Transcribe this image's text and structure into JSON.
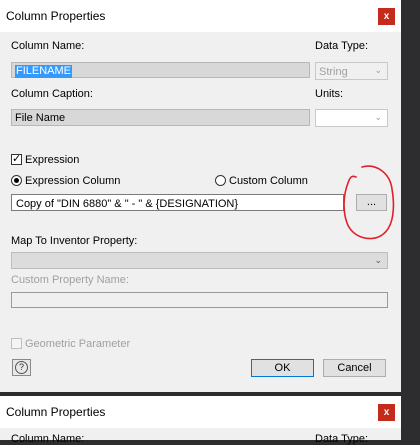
{
  "dialog": {
    "title": "Column Properties",
    "close_glyph": "x",
    "column_name_label": "Column Name:",
    "column_name_value": "FILENAME",
    "data_type_label": "Data Type:",
    "data_type_value": "String",
    "column_caption_label": "Column Caption:",
    "column_caption_value": "File Name",
    "units_label": "Units:",
    "expression_label": "Expression",
    "expression_checked": true,
    "expression_column_label": "Expression Column",
    "custom_column_label": "Custom Column",
    "expression_value": "Copy of \"DIN 6880\" & \" - \" & {DESIGNATION}",
    "ellipsis_label": "...",
    "map_label": "Map To Inventor Property:",
    "custom_property_label": "Custom Property Name:",
    "geometric_label": "Geometric Parameter",
    "ok_label": "OK",
    "cancel_label": "Cancel",
    "help_glyph": "?"
  },
  "second_dialog": {
    "title": "Column Properties",
    "close_glyph": "x",
    "column_name_label": "Column Name:",
    "data_type_label": "Data Type:"
  },
  "colors": {
    "title_close": "#c42b1c",
    "selection": "#3399ff",
    "annotation": "#e0202a"
  },
  "icons": [
    "close-icon",
    "chevron-down-icon",
    "help-icon"
  ]
}
